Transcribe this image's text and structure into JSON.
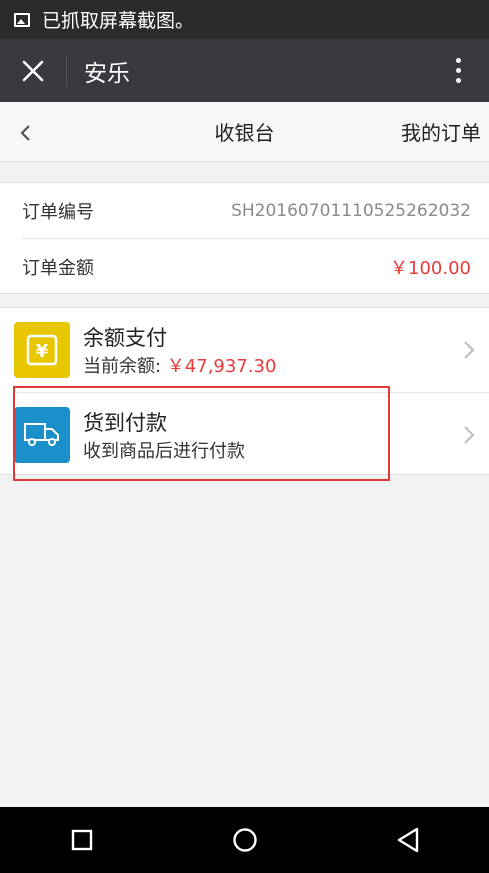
{
  "status_bar": {
    "text": "已抓取屏幕截图。",
    "icon": "image-icon"
  },
  "app_bar": {
    "title": "安乐",
    "close_icon": "close-icon",
    "more_icon": "more-vert-icon"
  },
  "page_header": {
    "title": "收银台",
    "right_link": "我的订单",
    "back_icon": "chevron-left-icon"
  },
  "order": {
    "number_label": "订单编号",
    "number_value": "SH2016070111052526203­2",
    "amount_label": "订单金额",
    "amount_value": "￥100.00"
  },
  "payment_methods": [
    {
      "title": "余额支付",
      "sub_label": "当前余额: ",
      "sub_value": "￥47,937.30",
      "icon": "yen-icon",
      "icon_color": "#e8c600"
    },
    {
      "title": "货到付款",
      "sub_label": "收到商品后进行付款",
      "icon": "truck-icon",
      "icon_color": "#1a8fc9"
    }
  ],
  "nav_bar": {
    "recents": "square-icon",
    "home": "circle-icon",
    "back": "triangle-back-icon"
  },
  "colors": {
    "accent_red": "#e83a3a",
    "highlight_border": "#e53935",
    "app_bar": "#393a3f"
  }
}
